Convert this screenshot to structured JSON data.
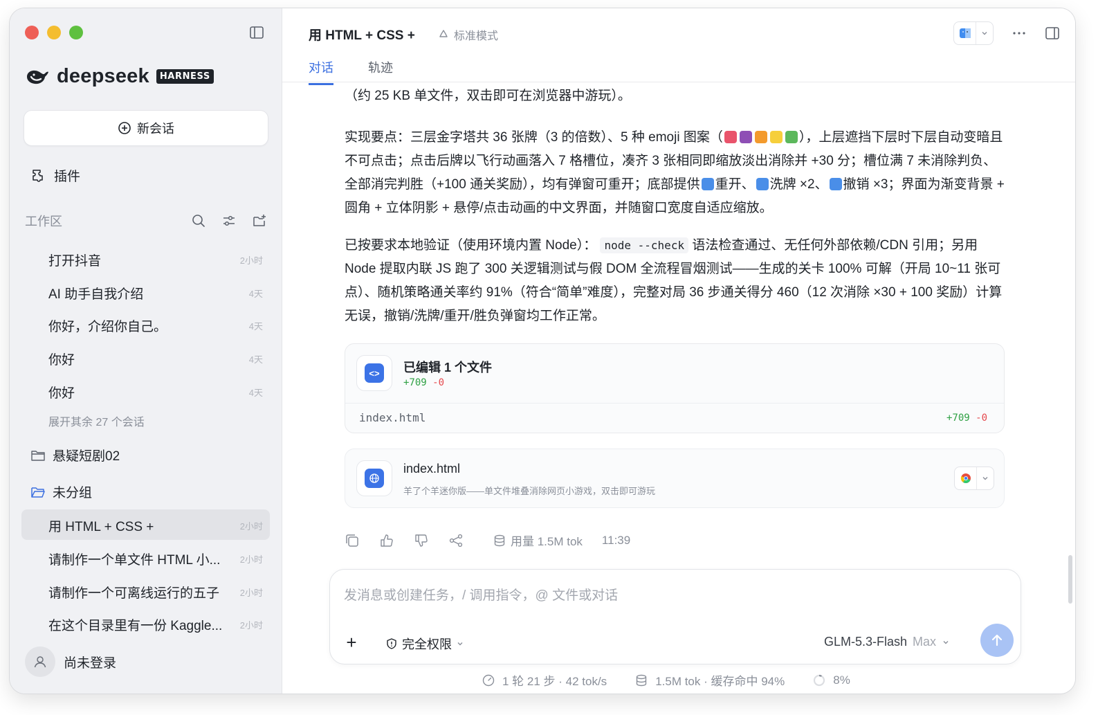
{
  "sidebar": {
    "brand": "deepseek",
    "badge": "HARNESS",
    "new_chat": "新会话",
    "plugins": "插件",
    "workspace": "工作区",
    "recent": [
      {
        "title": "打开抖音",
        "time": "2小时"
      },
      {
        "title": "AI 助手自我介绍",
        "time": "4天"
      },
      {
        "title": "你好，介绍你自己。",
        "time": "4天"
      },
      {
        "title": "你好",
        "time": "4天"
      },
      {
        "title": "你好",
        "time": "4天"
      }
    ],
    "expand_more": "展开其余 27 个会话",
    "folders": [
      {
        "name": "悬疑短剧02"
      },
      {
        "name": "未分组"
      }
    ],
    "grouped": [
      {
        "title": "用 HTML + CSS +",
        "time": "2小时"
      },
      {
        "title": "请制作一个单文件 HTML 小...",
        "time": "2小时"
      },
      {
        "title": "请制作一个可离线运行的五子",
        "time": "2小时"
      },
      {
        "title": "在这个目录里有一份 Kaggle...",
        "time": "2小时"
      }
    ],
    "login": "尚未登录"
  },
  "header": {
    "title": "用 HTML + CSS +",
    "mode": "标准模式",
    "tabs": [
      {
        "label": "对话",
        "active": true
      },
      {
        "label": "轨迹",
        "active": false
      }
    ]
  },
  "message": {
    "line0": "（约 25 KB 单文件，双击即可在浏览器中游玩）。",
    "p1_a": "实现要点：三层金字塔共 36 张牌（3 的倍数）、5 种 emoji 图案（",
    "p1_b": "），上层遮挡下层时下层自动变暗且不可点击；点击后牌以飞行动画落入 7 格槽位，凑齐 3 张相同即缩放淡出消除并 +30 分；槽位满 7 未消除判负、全部消完判胜（+100 通关奖励），均有弹窗可重开；底部提供",
    "p1_c": "重开、",
    "p1_d": "洗牌 ×2、",
    "p1_e": "撤销 ×3；界面为渐变背景 + 圆角 + 立体阴影 + 悬停/点击动画的中文界面，并随窗口宽度自适应缩放。",
    "p2_a": "已按要求本地验证（使用环境内置 Node）：",
    "p2_code": "node --check",
    "p2_b": "语法检查通过、无任何外部依赖/CDN 引用；另用 Node 提取内联 JS 跑了 300 关逻辑测试与假 DOM 全流程冒烟测试——生成的关卡 100% 可解（开局 10~11 张可点）、随机策略通关率约 91%（符合“简单”难度），完整对局 36 步通关得分 460（12 次消除 ×30 + 100 奖励）计算无误，撤销/洗牌/重开/胜负弹窗均工作正常。"
  },
  "edit_card": {
    "title": "已编辑 1 个文件",
    "added": "+709",
    "removed": "-0",
    "file": "index.html"
  },
  "file_card": {
    "name": "index.html",
    "desc": "羊了个羊迷你版——单文件堆叠消除网页小游戏，双击即可游玩"
  },
  "actions": {
    "usage": "用量 1.5M tok",
    "time": "11:39"
  },
  "composer": {
    "placeholder": "发消息或创建任务，/ 调用指令，@ 文件或对话",
    "permission": "完全权限",
    "model": "GLM-5.3-Flash",
    "tier": "Max"
  },
  "footer": {
    "steps": "1 轮 21 步 · 42 tok/s",
    "tokens": "1.5M tok · 缓存命中 94%",
    "context": "8%"
  },
  "colors": {
    "accent": "#3b6fe0",
    "added": "#2ea043",
    "removed": "#e5484d"
  }
}
